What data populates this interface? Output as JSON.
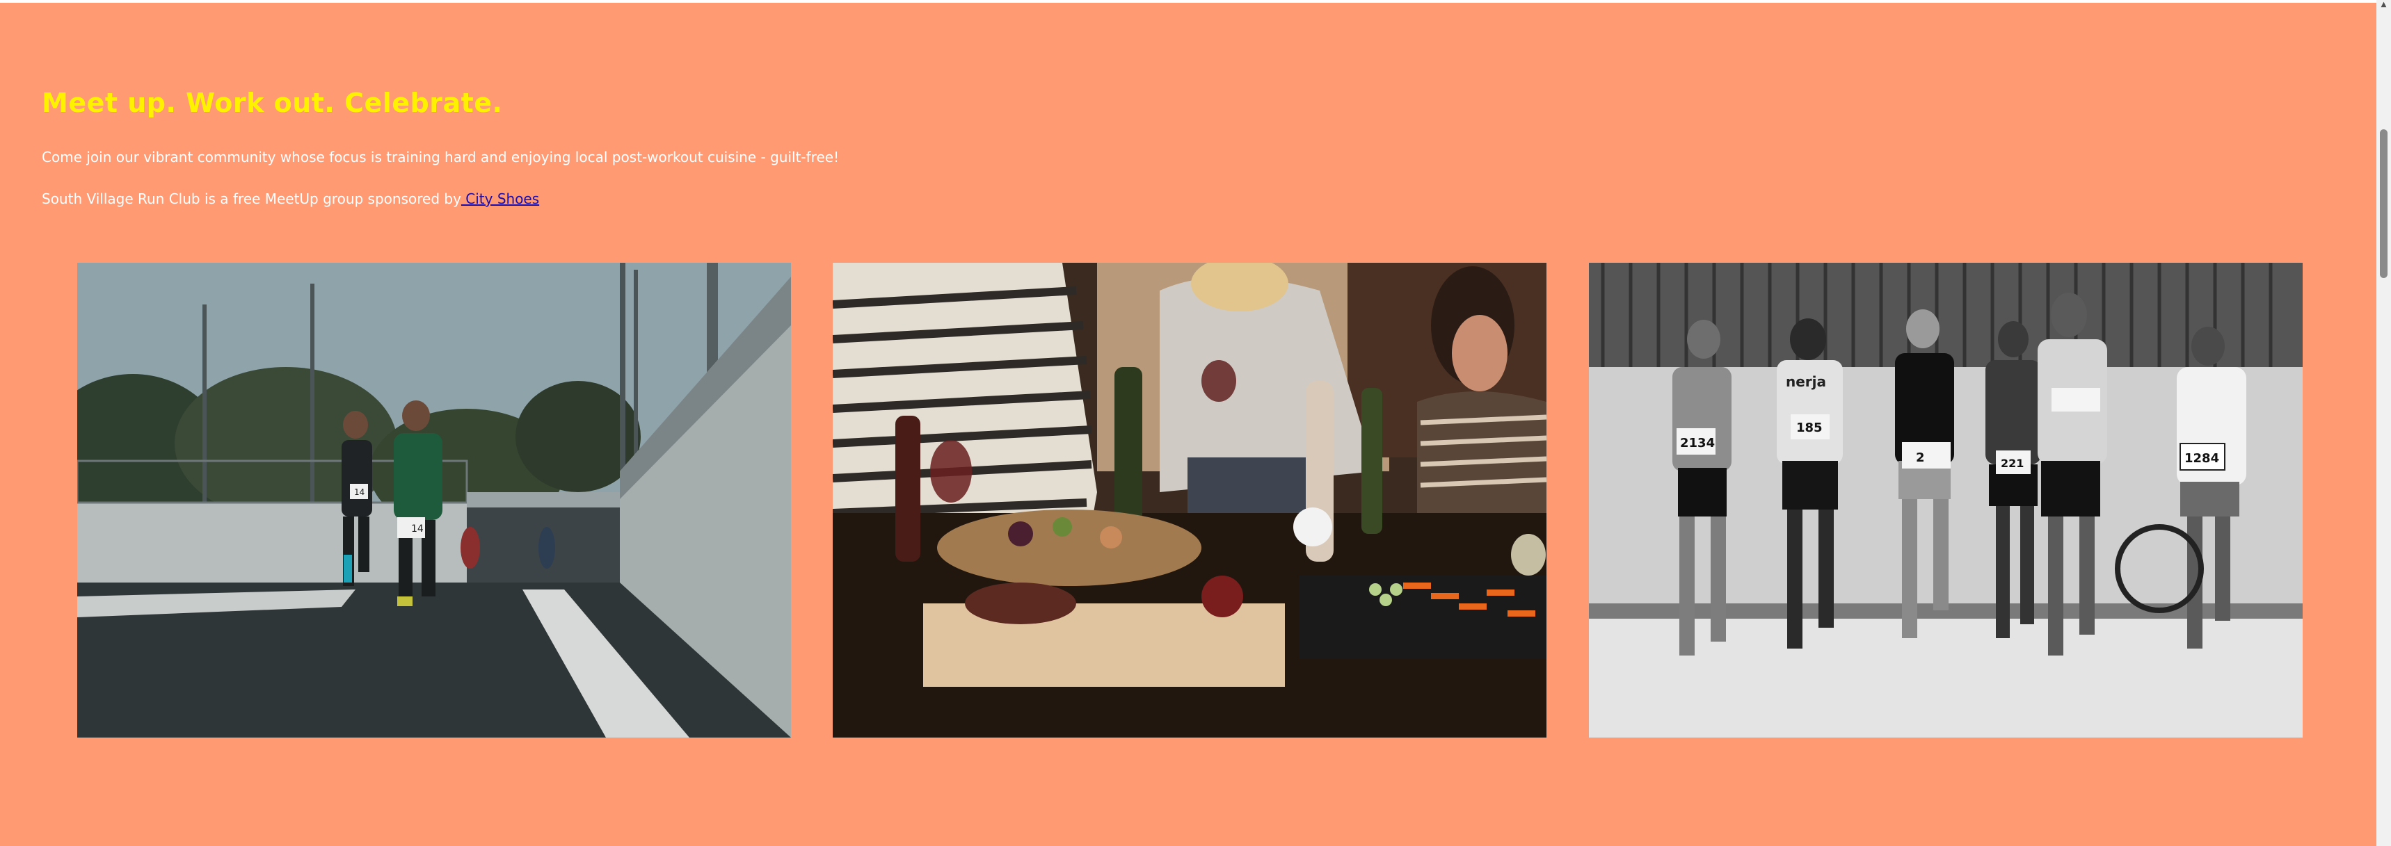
{
  "hero": {
    "heading": "Meet up. Work out. Celebrate.",
    "intro": "Come join our vibrant community whose focus is training hard and enjoying local post-workout cuisine - guilt-free!",
    "sponsor_prefix": "South Village Run Club is a free MeetUp group sponsored by",
    "sponsor_link": " City Shoes"
  },
  "gallery": {
    "photo_1_bibs": [
      "14",
      "14"
    ],
    "photo_3_bibs": [
      "2134",
      "185",
      "2",
      "221",
      "1284"
    ],
    "photo_3_shirt_text": "nerja"
  },
  "colors": {
    "page_background": "#ff9a73",
    "heading": "#fff200",
    "body_text": "#ffffff",
    "link": "#1a0dab"
  }
}
